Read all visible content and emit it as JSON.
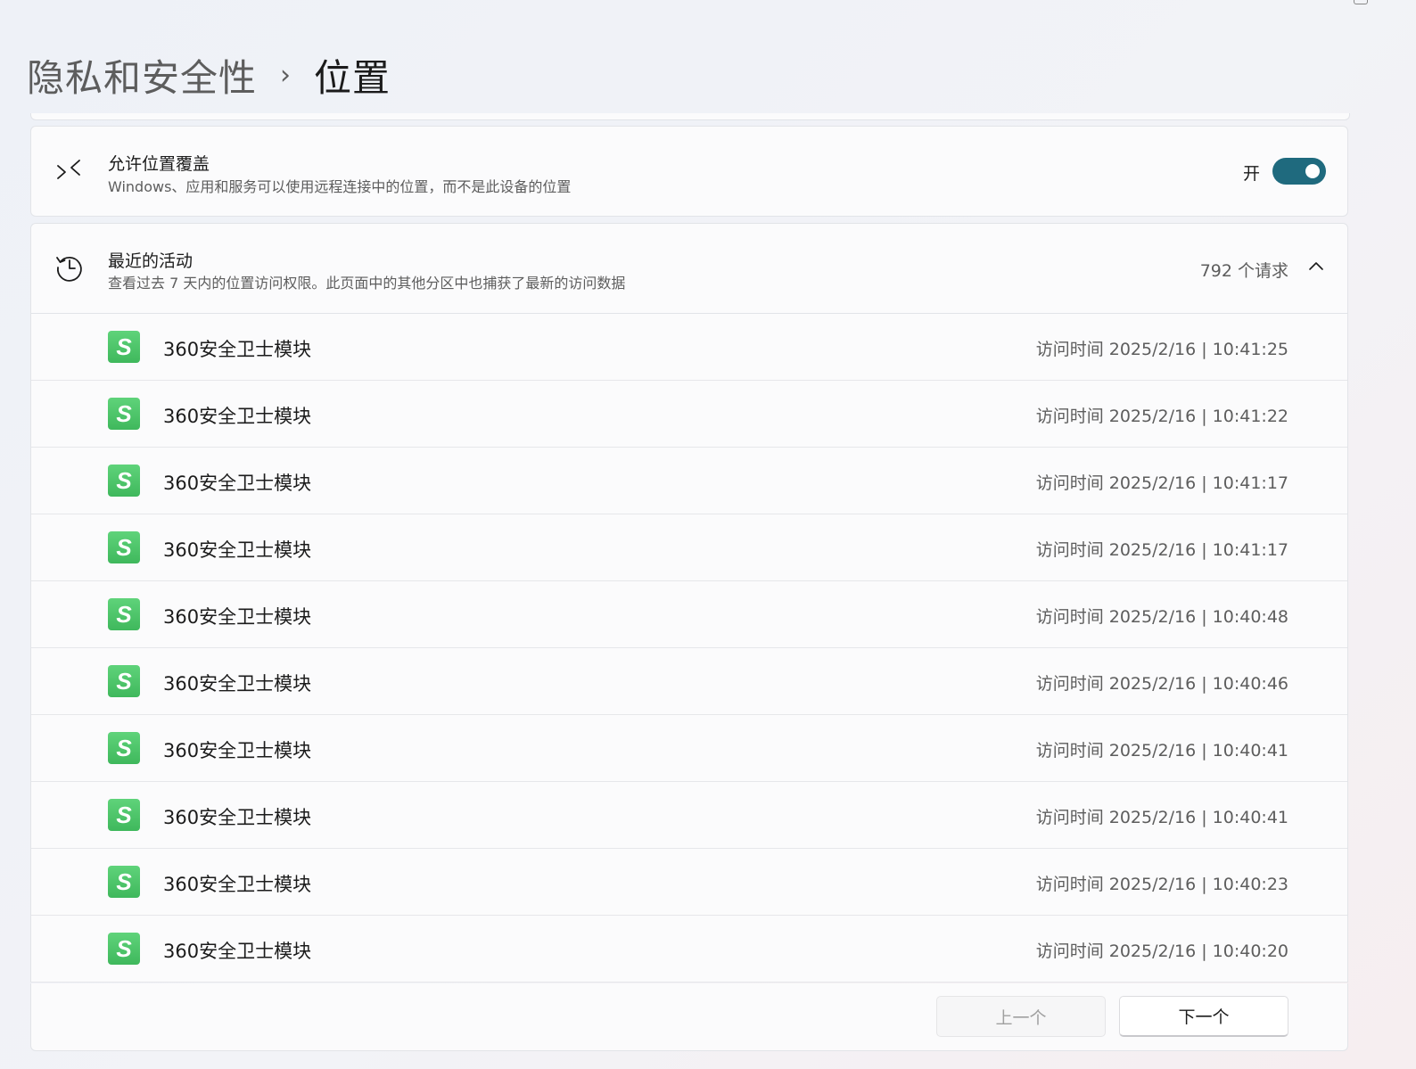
{
  "breadcrumb": {
    "parent": "隐私和安全性",
    "separator": "›",
    "current": "位置"
  },
  "override_setting": {
    "icon": "location-override-icon",
    "title": "允许位置覆盖",
    "description": "Windows、应用和服务可以使用远程连接中的位置，而不是此设备的位置",
    "toggle_label": "开",
    "toggle_on": true,
    "accent_color": "#1f6a7e"
  },
  "recent_activity": {
    "icon": "history-icon",
    "title": "最近的活动",
    "description": "查看过去 7 天内的位置访问权限。此页面中的其他分区中也捕获了最新的访问数据",
    "count": "792 个请求",
    "expanded": true,
    "items": [
      {
        "app": "360安全卫士模块",
        "icon_letter": "S",
        "time": "访问时间 2025/2/16 | 10:41:25"
      },
      {
        "app": "360安全卫士模块",
        "icon_letter": "S",
        "time": "访问时间 2025/2/16 | 10:41:22"
      },
      {
        "app": "360安全卫士模块",
        "icon_letter": "S",
        "time": "访问时间 2025/2/16 | 10:41:17"
      },
      {
        "app": "360安全卫士模块",
        "icon_letter": "S",
        "time": "访问时间 2025/2/16 | 10:41:17"
      },
      {
        "app": "360安全卫士模块",
        "icon_letter": "S",
        "time": "访问时间 2025/2/16 | 10:40:48"
      },
      {
        "app": "360安全卫士模块",
        "icon_letter": "S",
        "time": "访问时间 2025/2/16 | 10:40:46"
      },
      {
        "app": "360安全卫士模块",
        "icon_letter": "S",
        "time": "访问时间 2025/2/16 | 10:40:41"
      },
      {
        "app": "360安全卫士模块",
        "icon_letter": "S",
        "time": "访问时间 2025/2/16 | 10:40:41"
      },
      {
        "app": "360安全卫士模块",
        "icon_letter": "S",
        "time": "访问时间 2025/2/16 | 10:40:23"
      },
      {
        "app": "360安全卫士模块",
        "icon_letter": "S",
        "time": "访问时间 2025/2/16 | 10:40:20"
      }
    ]
  },
  "pagination": {
    "prev_label": "上一个",
    "prev_enabled": false,
    "next_label": "下一个",
    "next_enabled": true
  }
}
